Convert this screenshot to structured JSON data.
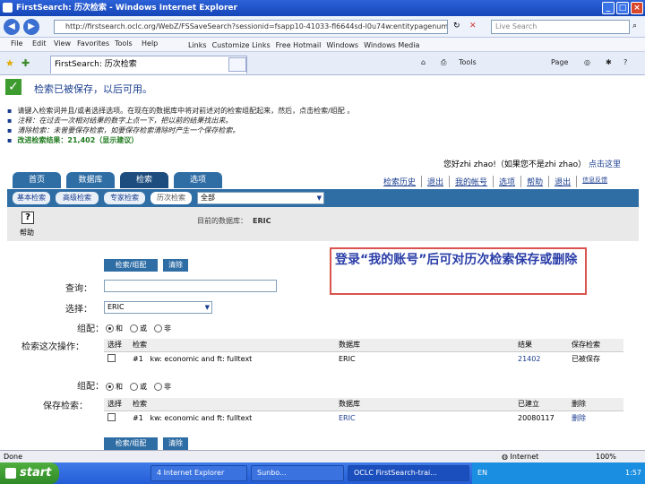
{
  "window": {
    "title": "FirstSearch: 历次检索 - Windows Internet Explorer"
  },
  "address": {
    "url": "http://firstsearch.oclc.org/WebZ/FSSaveSearch?sessionid=fsapp10-41033-fl6644sd-l0u74w:entitypagenum=22:0:saveView",
    "search_placeholder": "Live Search"
  },
  "menu": [
    "File",
    "Edit",
    "View",
    "Favorites",
    "Tools",
    "Help"
  ],
  "links_bar": [
    "Links",
    "Customize Links",
    "Free Hotmail",
    "Windows",
    "Windows Media"
  ],
  "tab": {
    "label": "FirstSearch: 历次检索"
  },
  "toolbar": {
    "page": "Page",
    "tools": "Tools"
  },
  "page": {
    "success": "检索已被保存，以后可用。",
    "bullets": [
      {
        "text": "请键入检索词并且/或者选择选项。在现在的数据库中将对前述对的检索组配起来，然后，点击检索/组配 。",
        "style": ""
      },
      {
        "text": "注释：在过去一次相对结果的数字上点一下，把以前的结果找出来。",
        "style": "it"
      },
      {
        "text": "清除检索：未曾要保存检索，如要保存检索清除时产生一个保存检索。",
        "style": "it"
      },
      {
        "text": "改进检索结果：21,402（显示建议）",
        "style": "green"
      }
    ],
    "user": {
      "greeting": "您好zhi zhao!（如果您不是zhi zhao）",
      "link": "点击这里"
    },
    "main_tabs": [
      "首页",
      "数据库",
      "检索",
      "选项"
    ],
    "top_links": [
      "检索历史",
      "退出",
      "我的帐号",
      "选项",
      "帮助",
      "退出",
      "信息反馈"
    ],
    "sub_tabs": [
      "基本检索",
      "高级检索",
      "专家检索",
      "历次检索"
    ],
    "db_select": "全部",
    "help": "帮助",
    "current_db_label": "目前的数据库：",
    "current_db": "ERIC",
    "buttons": {
      "search": "检索/组配",
      "clear": "清除"
    },
    "query_label": "查询：",
    "select_label": "选择：",
    "select_value": "ERIC",
    "combine_label": "组配：",
    "combine_opts": [
      "和",
      "或",
      "非"
    ],
    "session_label": "检索这次操作：",
    "session_table": {
      "headers": [
        "选择",
        "检索",
        "数据库",
        "结果",
        "保存检索"
      ],
      "rows": [
        [
          "",
          "#1",
          "kw: economic and ft: fulltext",
          "ERIC",
          "21402",
          "已被保存"
        ]
      ]
    },
    "saved_label": "保存检索：",
    "saved_table": {
      "headers": [
        "选择",
        "检索",
        "数据库",
        "已建立",
        "删除"
      ],
      "rows": [
        [
          "",
          "#1",
          "kw: economic and ft: fulltext",
          "ERIC",
          "20080117",
          "删除"
        ]
      ]
    },
    "callout": "登录“我的账号”后可对历次检索保存或删除"
  },
  "status": {
    "text": "Done",
    "zone": "Internet",
    "zoom": "100%"
  },
  "taskbar": {
    "start": "start",
    "tasks": [
      "4 Internet Explorer",
      "Sunbo...",
      "OCLC FirstSearch-trai..."
    ],
    "tray": "EN",
    "clock": "1:57"
  },
  "colors": {
    "accent": "#2f6da5",
    "callout_border": "#d9534f",
    "callout_text": "#2a3da8"
  }
}
